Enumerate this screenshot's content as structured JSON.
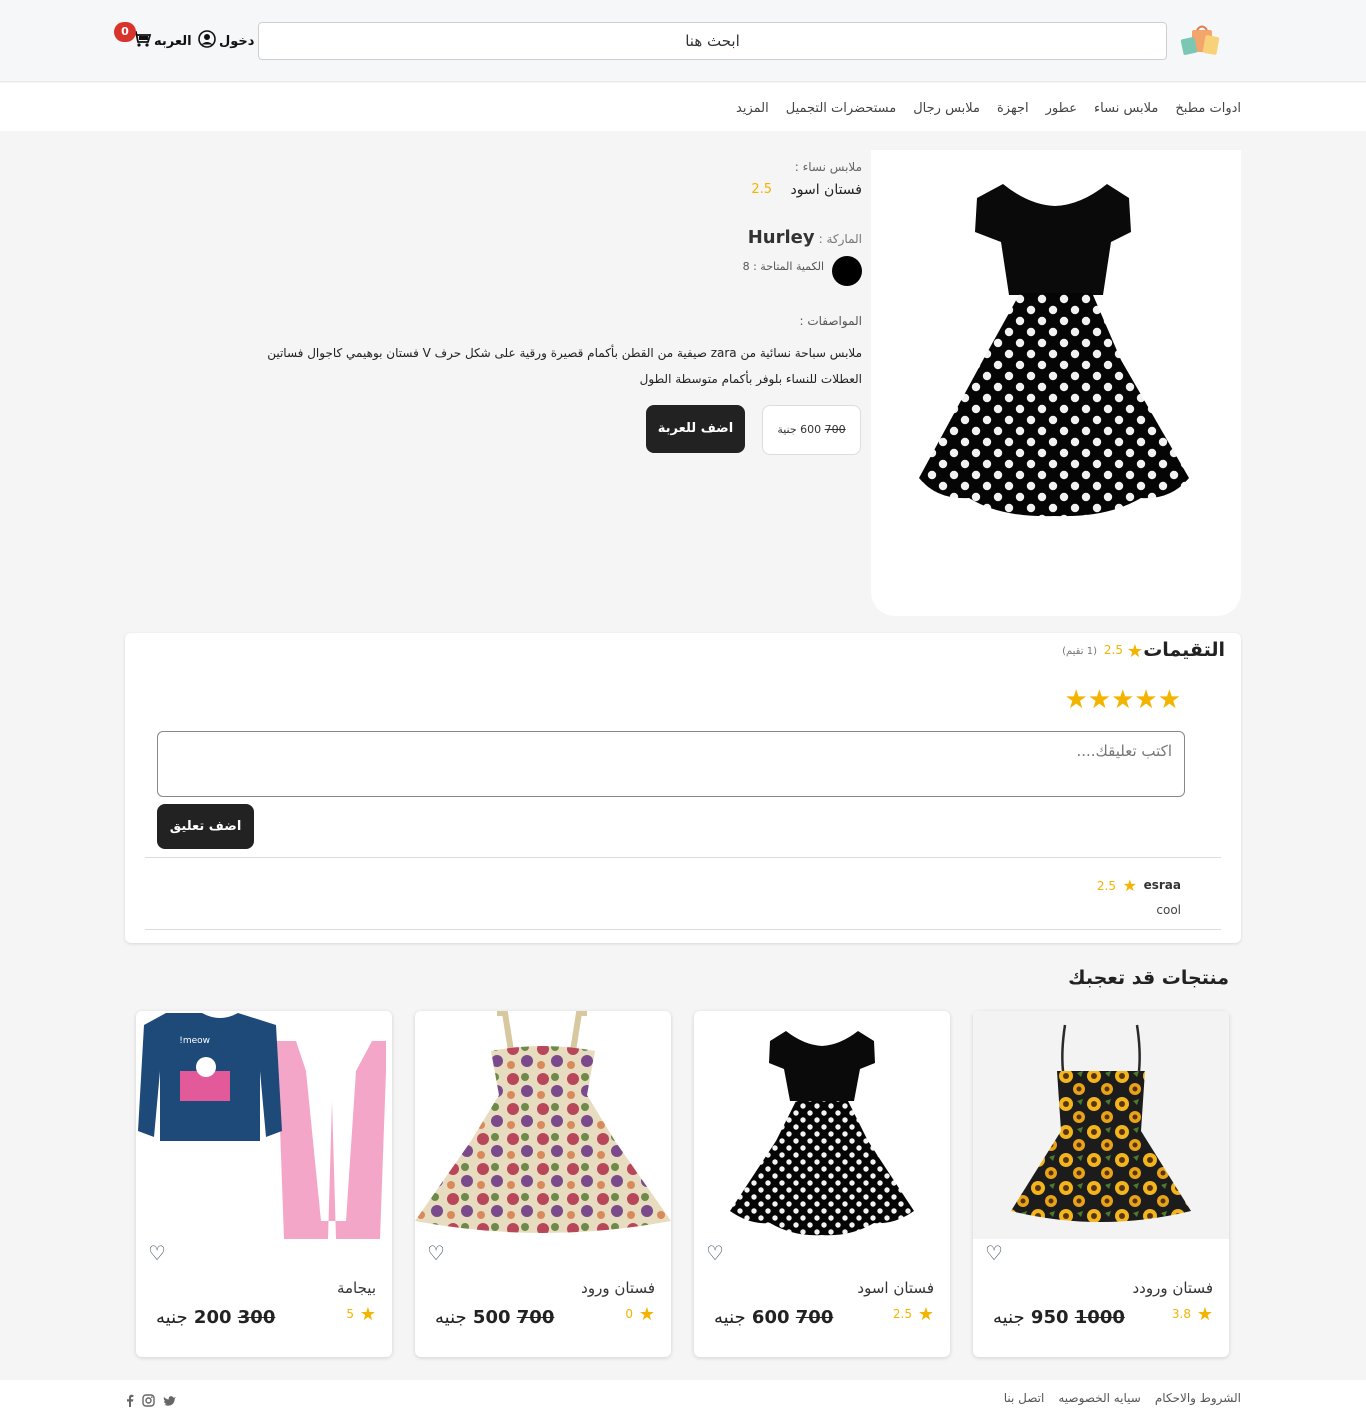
{
  "header": {
    "search_placeholder": "ابحث هنا",
    "login_label": "دخول",
    "cart_label": "العربه",
    "cart_count": "0"
  },
  "nav": {
    "categories": [
      "ادوات مطبخ",
      "ملابس نساء",
      "عطور",
      "اجهزة",
      "ملابس رجال",
      "مستحضرات التجميل",
      "المزيد"
    ]
  },
  "product": {
    "category_label": "ملابس نساء :",
    "title": "فستان اسود",
    "rating": "2.5",
    "brand_label": "الماركة :",
    "brand": "Hurley",
    "color": "#000000",
    "quantity_label": "الكمية المتاحة : 8",
    "specs_label": "المواصفات :",
    "specs_text": "ملابس سباحة نسائية من zara صيفية من القطن بأكمام قصيرة ورقية على شكل حرف V فستان بوهيمي كاجوال فساتين العطلات للنساء بلوفر بأكمام متوسطة الطول",
    "old_price": "700",
    "new_price": "600",
    "currency": "جنية",
    "add_to_cart_label": "اضف للعربة"
  },
  "reviews": {
    "title": "التقيمات",
    "average": "2.5",
    "count_label": "(1 تقيم)",
    "input_placeholder": "اكتب تعليقك....",
    "add_comment_label": "اضف تعليق",
    "stars": "★★★★★",
    "comments": [
      {
        "user": "esraa",
        "rating": "2.5",
        "text": "cool"
      }
    ]
  },
  "recommended": {
    "title": "منتجات قد تعجبك",
    "items": [
      {
        "name": "فستان ورودد",
        "rating": "3.8",
        "old_price": "1000",
        "new_price": "950",
        "currency": "جنيه"
      },
      {
        "name": "فستان اسود",
        "rating": "2.5",
        "old_price": "700",
        "new_price": "600",
        "currency": "جنيه"
      },
      {
        "name": "فستان ورود",
        "rating": "0",
        "old_price": "700",
        "new_price": "500",
        "currency": "جنيه"
      },
      {
        "name": "بيجامة",
        "rating": "5",
        "old_price": "300",
        "new_price": "200",
        "currency": "جنيه"
      }
    ]
  },
  "footer": {
    "links": [
      "الشروط والاحكام",
      "سيايه الخصوصيه",
      "اتصل بنا"
    ]
  },
  "colors": {
    "accent_dark": "#222222",
    "star": "#f3b400",
    "badge": "#d8342b"
  }
}
